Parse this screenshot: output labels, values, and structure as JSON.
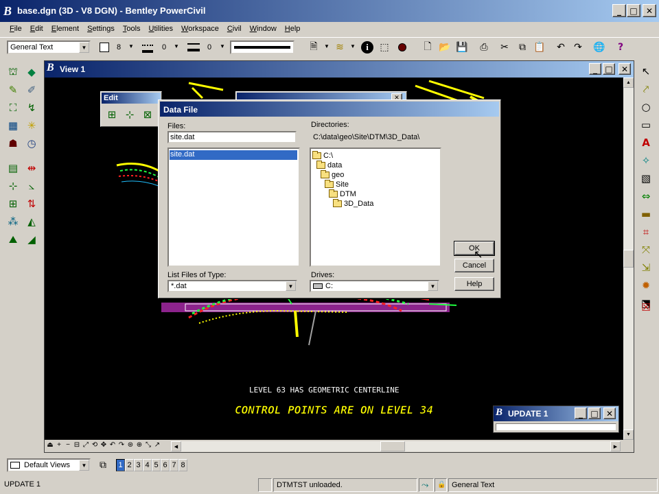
{
  "app": {
    "logo": "B",
    "title": "base.dgn (3D - V8 DGN) - Bentley PowerCivil"
  },
  "menu": [
    "File",
    "Edit",
    "Element",
    "Settings",
    "Tools",
    "Utilities",
    "Workspace",
    "Civil",
    "Window",
    "Help"
  ],
  "toolbar": {
    "text_style": "General Text",
    "color_value": "8",
    "style_value": "0",
    "weight_value": "0"
  },
  "view": {
    "logo": "B",
    "title": "View 1",
    "cad_text_1": "LEVEL 63 HAS GEOMETRIC CENTERLINE",
    "cad_text_2": "CONTROL POINTS ARE ON LEVEL 34"
  },
  "edit_palette": {
    "title": "Edit"
  },
  "dialog": {
    "title": "Data File",
    "files_label": "Files:",
    "files_value": "site.dat",
    "file_list": [
      "site.dat"
    ],
    "directories_label": "Directories:",
    "current_path": "C:\\data\\geo\\Site\\DTM\\3D_Data\\",
    "directories": [
      "C:\\",
      "data",
      "geo",
      "Site",
      "DTM",
      "3D_Data"
    ],
    "type_label": "List Files of Type:",
    "type_value": "*.dat",
    "drives_label": "Drives:",
    "drive_value": "C:",
    "ok": "OK",
    "cancel": "Cancel",
    "help": "Help"
  },
  "update_window": {
    "logo": "B",
    "title": "UPDATE 1"
  },
  "views_bar": {
    "views_combo": "Default Views",
    "view_numbers": [
      "1",
      "2",
      "3",
      "4",
      "5",
      "6",
      "7",
      "8"
    ]
  },
  "status": {
    "left": "UPDATE 1",
    "message": "DTMTST unloaded.",
    "active_text": "General Text"
  },
  "colors": {
    "titlebar_start": "#0a246a",
    "titlebar_end": "#a6caf0",
    "canvas": "#000000",
    "cad_yellow": "#ffff00",
    "cad_red": "#ff2020",
    "cad_green": "#20ff40"
  }
}
